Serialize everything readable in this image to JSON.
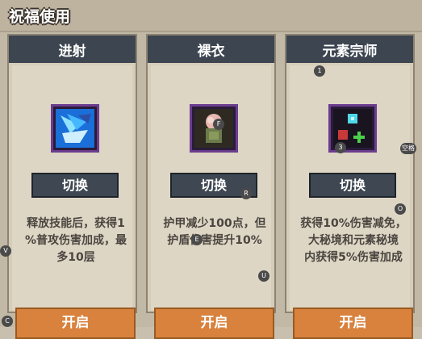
{
  "window": {
    "title": "祝福使用"
  },
  "cards": [
    {
      "title": "进射",
      "icon": "blue-sword-burst-icon",
      "switch_label": "切换",
      "description_lines": [
        "释放技能后，获得1",
        "%普攻伤害加成，最",
        "多10层"
      ],
      "open_label": "开启"
    },
    {
      "title": "裸衣",
      "icon": "rose-cloth-icon",
      "switch_label": "切换",
      "description_lines": [
        "护甲减少100点，但",
        "护盾伤害提升10%"
      ],
      "open_label": "开启"
    },
    {
      "title": "元素宗师",
      "icon": "element-orbs-icon",
      "switch_label": "切换",
      "description_lines": [
        "获得10%伤害减免，",
        "大秘境和元素秘境",
        "内获得5%伤害加成"
      ],
      "open_label": "开启"
    }
  ],
  "hints": {
    "one": "1",
    "f": "F",
    "three": "3",
    "space": "空格",
    "r": "R",
    "o": "O",
    "e": "E",
    "v": "V",
    "u": "U",
    "c": "C"
  },
  "colors": {
    "panel_header": "#3c4550",
    "open_button": "#d8823e",
    "icon_frame": "#6b3c8f"
  }
}
